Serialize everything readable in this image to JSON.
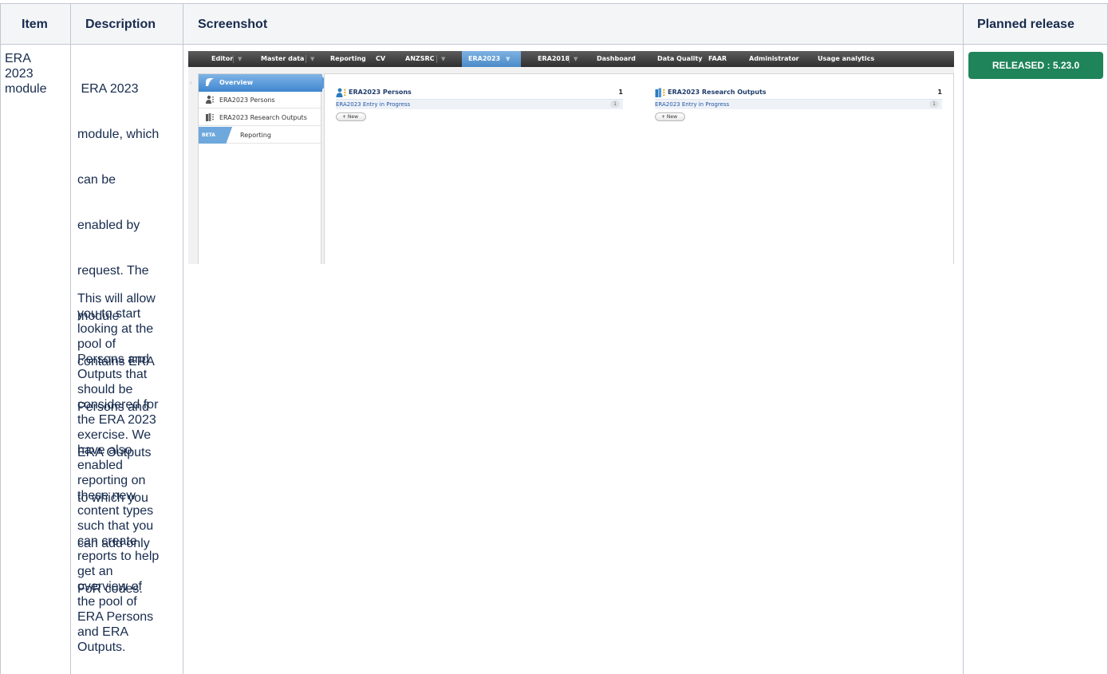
{
  "table": {
    "headers": {
      "item": "Item",
      "description": "Description",
      "screenshot": "Screenshot",
      "planned_release": "Planned release"
    },
    "row": {
      "item_lines": [
        "ERA",
        "2023",
        "module"
      ],
      "description_p1_lines": [
        " ERA 2023",
        "module, which",
        "can be",
        "enabled by",
        "request. The",
        "module",
        "contains ERA",
        "Persons and",
        "ERA Outputs",
        "to which you",
        "can add only",
        "FoR codes."
      ],
      "description_p2_lines": [
        "This will allow",
        "you to start",
        "looking at the",
        "pool of",
        "Persons and",
        "Outputs that",
        "should be",
        "considered for",
        "the ERA 2023",
        "exercise. We",
        "have also",
        "enabled",
        "reporting on",
        "these new",
        "content types",
        "such that you",
        "can create",
        "reports to help",
        "get an",
        "overview of",
        "the pool of",
        "ERA Persons",
        "and ERA",
        "Outputs."
      ],
      "release_status": "RELEASED : 5.23.0"
    }
  },
  "app": {
    "nav": {
      "editor": "Editor",
      "master_data": "Master data",
      "reporting": "Reporting",
      "cv": "CV",
      "anzsrc": "ANZSRC",
      "era2023": "ERA2023",
      "era2018": "ERA2018",
      "dashboard": "Dashboard",
      "data_quality": "Data Quality",
      "faar": "FAAR",
      "administrator": "Administrator",
      "usage_analytics": "Usage analytics"
    },
    "sidebar": {
      "overview": "Overview",
      "persons": "ERA2023 Persons",
      "outputs": "ERA2023 Research Outputs",
      "beta": "BETA",
      "reporting": "Reporting"
    },
    "panels": {
      "persons": {
        "title": "ERA2023 Persons",
        "count": "1",
        "row_label": "ERA2023 Entry in Progress",
        "row_count": "1",
        "new_label": "+ New"
      },
      "outputs": {
        "title": "ERA2023 Research Outputs",
        "count": "1",
        "row_label": "ERA2023 Entry in Progress",
        "row_count": "1",
        "new_label": "+ New"
      }
    }
  },
  "colors": {
    "released_badge": "#1f845a",
    "nav_active": "#4a8bc9",
    "link": "#2256a6"
  }
}
